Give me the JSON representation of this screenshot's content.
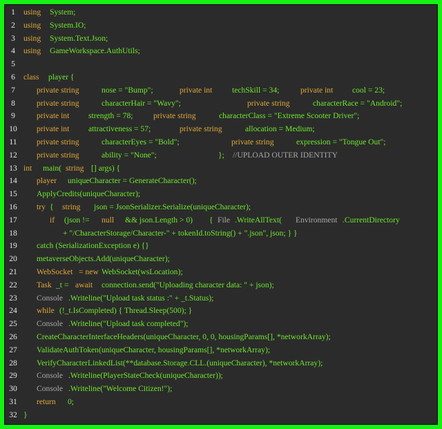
{
  "colors": {
    "border": "#16f216",
    "background": "#2b2b2b",
    "keyword": "#e0a83a",
    "identifier": "#6fe82e",
    "plain": "#a8a8a8",
    "line_number": "#e6e6e6"
  },
  "code_lines": [
    {
      "n": "1",
      "tokens": [
        {
          "t": "using",
          "c": "y"
        },
        {
          "t": "System;",
          "c": "g"
        }
      ]
    },
    {
      "n": "2",
      "tokens": [
        {
          "t": "using",
          "c": "y"
        },
        {
          "t": "System.IO;",
          "c": "g"
        }
      ]
    },
    {
      "n": "3",
      "tokens": [
        {
          "t": "using",
          "c": "y"
        },
        {
          "t": "System.Text.Json;",
          "c": "g"
        }
      ]
    },
    {
      "n": "4",
      "tokens": [
        {
          "t": "using",
          "c": "y"
        },
        {
          "t": "GameWorkspace.AuthUtils;",
          "c": "g"
        }
      ]
    },
    {
      "n": "5",
      "tokens": []
    },
    {
      "n": "6",
      "tokens": [
        {
          "t": "class",
          "c": "y"
        },
        {
          "t": "player {",
          "c": "g"
        }
      ]
    },
    {
      "n": "7",
      "tokens": [
        {
          "t": "private string",
          "c": "y"
        },
        {
          "t": "nose = \"Bump\";",
          "c": "g"
        },
        {
          "t": "private int",
          "c": "y"
        },
        {
          "t": "techSkill = 34;",
          "c": "g"
        },
        {
          "t": "private int",
          "c": "y"
        },
        {
          "t": "cool = 23;",
          "c": "g"
        }
      ]
    },
    {
      "n": "8",
      "tokens": [
        {
          "t": "private string",
          "c": "y"
        },
        {
          "t": "characterHair = \"Wavy\";",
          "c": "g"
        },
        {
          "t": "private string",
          "c": "y"
        },
        {
          "t": "characterRace = \"Android\";",
          "c": "g"
        }
      ]
    },
    {
      "n": "9",
      "tokens": [
        {
          "t": "private int",
          "c": "y"
        },
        {
          "t": "strength = 78;",
          "c": "g"
        },
        {
          "t": "private string",
          "c": "y"
        },
        {
          "t": "characterClass = \"Extreme Scooter Driver\";",
          "c": "g"
        }
      ]
    },
    {
      "n": "10",
      "tokens": [
        {
          "t": "private int",
          "c": "y"
        },
        {
          "t": "attractiveness = 57;",
          "c": "g"
        },
        {
          "t": "private string",
          "c": "y"
        },
        {
          "t": "allocation = Medium;",
          "c": "g"
        }
      ]
    },
    {
      "n": "11",
      "tokens": [
        {
          "t": "private string",
          "c": "y"
        },
        {
          "t": "characterEyes = \"Bold\";",
          "c": "g"
        },
        {
          "t": "private string",
          "c": "y"
        },
        {
          "t": "expression = \"Tongue Out\";",
          "c": "g"
        }
      ]
    },
    {
      "n": "12",
      "tokens": [
        {
          "t": "private string",
          "c": "y"
        },
        {
          "t": "ability = \"None\";",
          "c": "g"
        },
        {
          "t": "};",
          "c": "g"
        },
        {
          "t": "//UPLOAD OUTER IDENTITY",
          "c": "w"
        }
      ]
    },
    {
      "n": "13",
      "tokens": [
        {
          "t": "int",
          "c": "y"
        },
        {
          "t": "main(",
          "c": "g"
        },
        {
          "t": "string",
          "c": "y"
        },
        {
          "t": "[] args) {",
          "c": "g"
        }
      ]
    },
    {
      "n": "14",
      "tokens": [
        {
          "t": "player",
          "c": "y"
        },
        {
          "t": "uniqueCharacter = GenerateCharacter();",
          "c": "g"
        }
      ]
    },
    {
      "n": "15",
      "tokens": [
        {
          "t": "ApplyCredits(uniqueCharacter);",
          "c": "g"
        }
      ]
    },
    {
      "n": "16",
      "tokens": [
        {
          "t": "try",
          "c": "y"
        },
        {
          "t": "{",
          "c": "g"
        },
        {
          "t": "string",
          "c": "y"
        },
        {
          "t": "json = JsonSerializer.Serialize(uniqueCharacter);",
          "c": "g"
        }
      ]
    },
    {
      "n": "17",
      "tokens": [
        {
          "t": "if",
          "c": "y"
        },
        {
          "t": "(json !=",
          "c": "g"
        },
        {
          "t": "null",
          "c": "y"
        },
        {
          "t": "&& json.Length > 0)",
          "c": "g"
        },
        {
          "t": "{",
          "c": "g"
        },
        {
          "t": "File",
          "c": "w"
        },
        {
          "t": ".WriteAllText(",
          "c": "g"
        },
        {
          "t": "Environment",
          "c": "w"
        },
        {
          "t": ".CurrentDirectory",
          "c": "g"
        }
      ]
    },
    {
      "n": "18",
      "tokens": [
        {
          "t": "+ \"/CharacterStorage/Character-\" + tokenId.toString() + \".json\", json; } }",
          "c": "g"
        }
      ]
    },
    {
      "n": "19",
      "tokens": [
        {
          "t": "catch (SerializationException e) {}",
          "c": "g"
        }
      ]
    },
    {
      "n": "20",
      "tokens": [
        {
          "t": "metaverseObjects.Add(uniqueCharacter);",
          "c": "g"
        }
      ]
    },
    {
      "n": "21",
      "tokens": [
        {
          "t": "WebSocket",
          "c": "y"
        },
        {
          "t": "= new",
          "c": "y"
        },
        {
          "t": "WebSocket(wsLocation);",
          "c": "g"
        }
      ]
    },
    {
      "n": "22",
      "tokens": [
        {
          "t": "Task",
          "c": "y"
        },
        {
          "t": "_t =",
          "c": "g"
        },
        {
          "t": "await",
          "c": "y"
        },
        {
          "t": "connection.send(\"Uploading character data: \" + json);",
          "c": "g"
        }
      ]
    },
    {
      "n": "23",
      "tokens": [
        {
          "t": "Console",
          "c": "w"
        },
        {
          "t": ".Writeline(\"Upload task status :\" + _t.Status);",
          "c": "g"
        }
      ]
    },
    {
      "n": "24",
      "tokens": [
        {
          "t": "while",
          "c": "y"
        },
        {
          "t": "(!_t.IsCompleted) { Thread.Sleep(500); }",
          "c": "g"
        }
      ]
    },
    {
      "n": "25",
      "tokens": [
        {
          "t": "Console",
          "c": "w"
        },
        {
          "t": ".Writeline(\"Upload task completed\");",
          "c": "g"
        }
      ]
    },
    {
      "n": "26",
      "tokens": [
        {
          "t": "CreateCharacterInterfaceHeaders(uniqueCharacter, 0, 0, housingParams[], *networkArray);",
          "c": "g"
        }
      ]
    },
    {
      "n": "27",
      "tokens": [
        {
          "t": "ValidateAuthToken(uniqueCharacter, housingParams[], *networkArray);",
          "c": "g"
        }
      ]
    },
    {
      "n": "28",
      "tokens": [
        {
          "t": "VerifyCharacterLinkedList(**database.Storage.CLL.(uniqueCharacter), *networkArray);",
          "c": "g"
        }
      ]
    },
    {
      "n": "29",
      "tokens": [
        {
          "t": "Console",
          "c": "w"
        },
        {
          "t": ".Writeline(PlayerStateCheck(uniqueCharacter));",
          "c": "g"
        }
      ]
    },
    {
      "n": "30",
      "tokens": [
        {
          "t": "Console",
          "c": "w"
        },
        {
          "t": ".Writeline(\"Welcome Citizen!\");",
          "c": "g"
        }
      ]
    },
    {
      "n": "31",
      "tokens": [
        {
          "t": "return",
          "c": "y"
        },
        {
          "t": "0;",
          "c": "g"
        }
      ]
    },
    {
      "n": "32",
      "tokens": [
        {
          "t": "}",
          "c": "g"
        }
      ]
    }
  ]
}
